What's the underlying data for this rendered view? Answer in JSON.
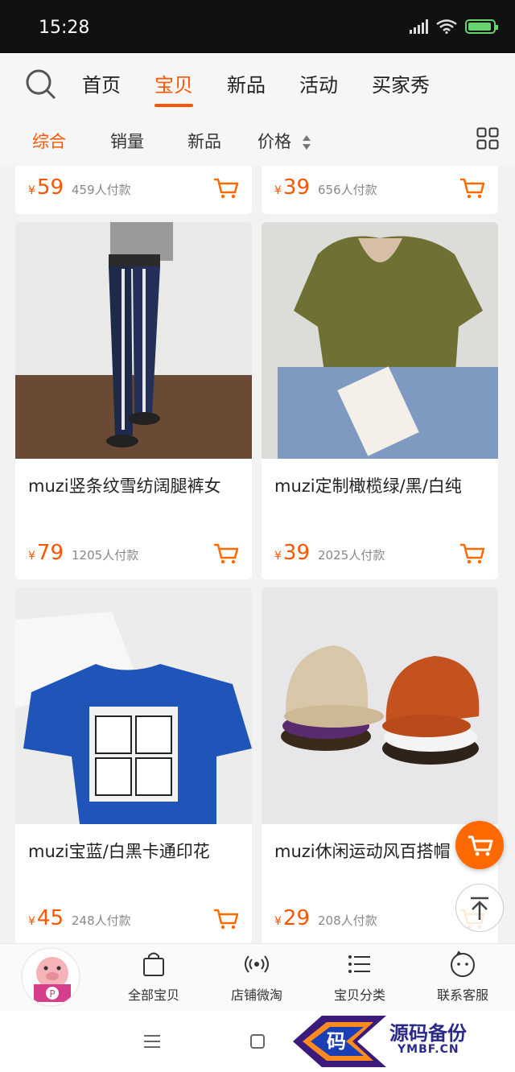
{
  "status_bar": {
    "time": "15:28"
  },
  "top_nav": {
    "tabs": [
      {
        "label": "首页",
        "active": false
      },
      {
        "label": "宝贝",
        "active": true
      },
      {
        "label": "新品",
        "active": false
      },
      {
        "label": "活动",
        "active": false
      },
      {
        "label": "买家秀",
        "active": false
      }
    ]
  },
  "sort_bar": {
    "items": [
      {
        "label": "综合",
        "active": true
      },
      {
        "label": "销量",
        "active": false
      },
      {
        "label": "新品",
        "active": false
      },
      {
        "label": "价格",
        "active": false
      }
    ]
  },
  "products": [
    {
      "title": "",
      "currency": "¥",
      "price": "59",
      "sold": "459人付款"
    },
    {
      "title": "",
      "currency": "¥",
      "price": "39",
      "sold": "656人付款"
    },
    {
      "title": "muzi竖条纹雪纺阔腿裤女",
      "currency": "¥",
      "price": "79",
      "sold": "1205人付款"
    },
    {
      "title": "muzi定制橄榄绿/黑/白纯",
      "currency": "¥",
      "price": "39",
      "sold": "2025人付款"
    },
    {
      "title": "muzi宝蓝/白黑卡通印花",
      "currency": "¥",
      "price": "45",
      "sold": "248人付款"
    },
    {
      "title": "muzi休闲运动风百搭帽",
      "currency": "¥",
      "price": "29",
      "sold": "208人付款"
    }
  ],
  "shop_bar": {
    "items": [
      {
        "label": "全部宝贝",
        "icon": "bag-icon"
      },
      {
        "label": "店铺微淘",
        "icon": "broadcast-icon"
      },
      {
        "label": "宝贝分类",
        "icon": "list-icon"
      },
      {
        "label": "联系客服",
        "icon": "service-icon"
      }
    ]
  },
  "watermark": {
    "brand": "源码备份",
    "domain": "YMBF.CN",
    "badge": "码"
  },
  "colors": {
    "accent": "#ff5500",
    "fab": "#ff6a00"
  }
}
